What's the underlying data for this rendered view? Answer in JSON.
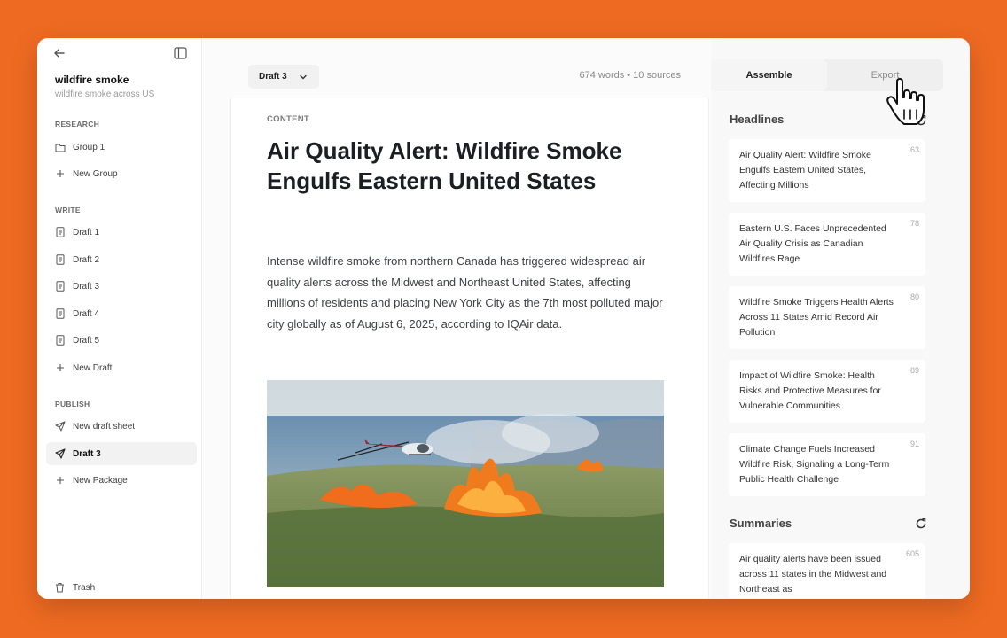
{
  "sidebar": {
    "project_title": "wildfire smoke",
    "project_subtitle": "wildfire smoke across US",
    "research_label": "RESEARCH",
    "research_items": [
      {
        "label": "Group 1",
        "icon": "folder-icon"
      },
      {
        "label": "New Group",
        "icon": "plus-icon"
      }
    ],
    "write_label": "WRITE",
    "write_items": [
      {
        "label": "Draft 1",
        "icon": "document-icon"
      },
      {
        "label": "Draft 2",
        "icon": "document-icon"
      },
      {
        "label": "Draft 3",
        "icon": "document-icon"
      },
      {
        "label": "Draft 4",
        "icon": "document-icon"
      },
      {
        "label": "Draft 5",
        "icon": "document-icon"
      },
      {
        "label": "New Draft",
        "icon": "plus-icon"
      }
    ],
    "publish_label": "PUBLISH",
    "publish_items": [
      {
        "label": "New draft sheet",
        "icon": "send-icon"
      },
      {
        "label": "Draft 3",
        "icon": "send-icon",
        "active": true
      },
      {
        "label": "New Package",
        "icon": "plus-icon"
      }
    ],
    "trash_label": "Trash"
  },
  "editor": {
    "draft_selector": "Draft 3",
    "stats": "674 words • 10 sources",
    "content_label": "CONTENT",
    "headline": "Air Quality Alert: Wildfire Smoke Engulfs Eastern United States",
    "body": "Intense wildfire smoke from northern Canada has triggered widespread air quality alerts across the Midwest and Northeast United States, affecting millions of residents and placing New York City as the 7th most polluted major city globally as of August 6, 2025, according to IQAir data."
  },
  "panel": {
    "tabs": {
      "assemble": "Assemble",
      "export": "Export"
    },
    "headlines_title": "Headlines",
    "headlines": [
      {
        "text": "Air Quality Alert: Wildfire Smoke Engulfs Eastern United States, Affecting Millions",
        "score": "63"
      },
      {
        "text": "Eastern U.S. Faces Unprecedented Air Quality Crisis as Canadian Wildfires Rage",
        "score": "78"
      },
      {
        "text": "Wildfire Smoke Triggers Health Alerts Across 11 States Amid Record Air Pollution",
        "score": "80"
      },
      {
        "text": "Impact of Wildfire Smoke: Health Risks and Protective Measures for Vulnerable Communities",
        "score": "89"
      },
      {
        "text": "Climate Change Fuels Increased Wildfire Risk, Signaling a Long-Term Public Health Challenge",
        "score": "91"
      }
    ],
    "summaries_title": "Summaries",
    "summaries": [
      {
        "text": "Air quality alerts have been issued across 11 states in the Midwest and Northeast as",
        "score": "605"
      }
    ]
  },
  "colors": {
    "background": "#ee6a22",
    "window": "#ffffff",
    "panel": "#f8f8f8"
  }
}
